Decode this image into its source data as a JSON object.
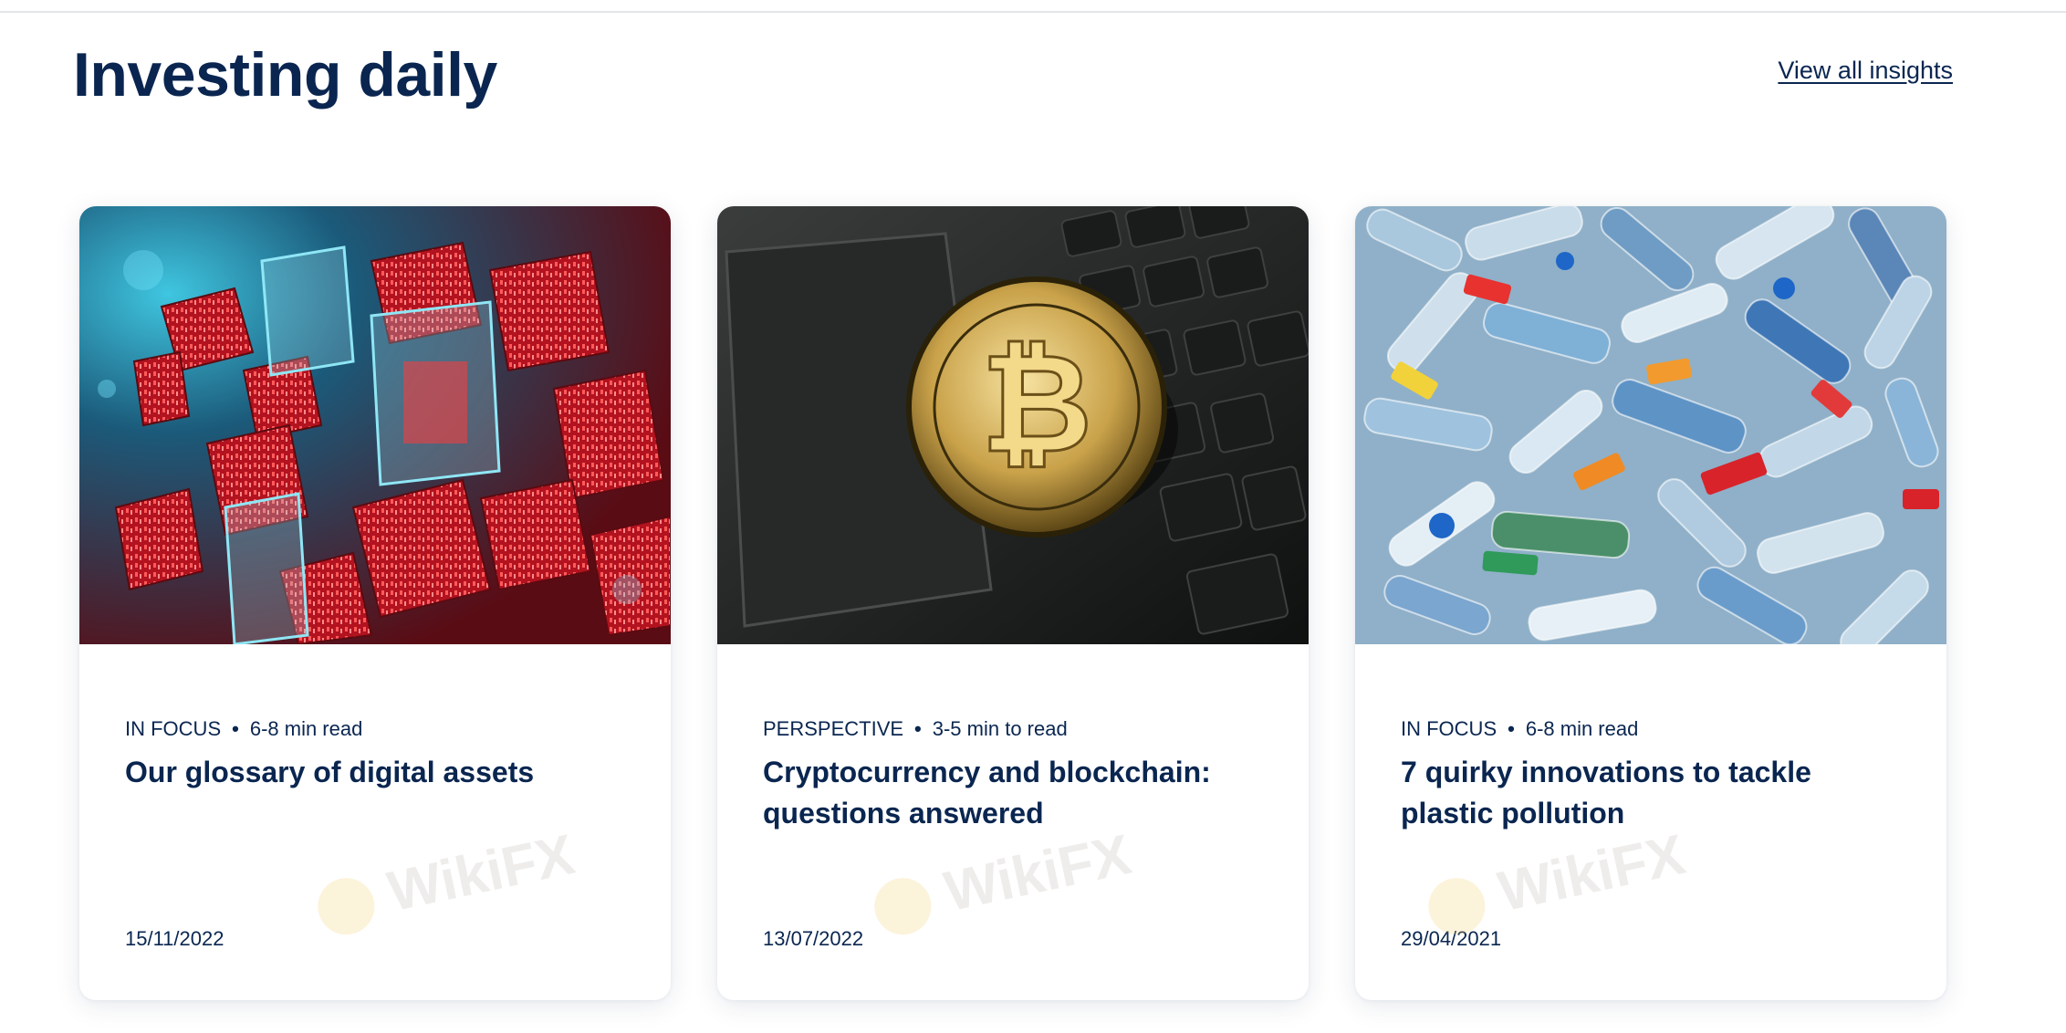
{
  "header": {
    "title": "Investing daily",
    "view_all": "View all insights"
  },
  "cards": [
    {
      "category": "IN FOCUS",
      "read_time": "6-8 min read",
      "title": "Our glossary of digital assets",
      "date": "15/11/2022",
      "image": "digital-assets-image"
    },
    {
      "category": "PERSPECTIVE",
      "read_time": "3-5 min to read",
      "title": "Cryptocurrency and blockchain: questions answered",
      "date": "13/07/2022",
      "image": "bitcoin-keyboard-image"
    },
    {
      "category": "IN FOCUS",
      "read_time": "6-8 min read",
      "title": "7 quirky innovations to tackle plastic pollution",
      "date": "29/04/2021",
      "image": "plastic-bottles-image"
    }
  ],
  "watermark": "WikiFX",
  "colors": {
    "primary_text": "#0a2650",
    "background": "#ffffff"
  }
}
